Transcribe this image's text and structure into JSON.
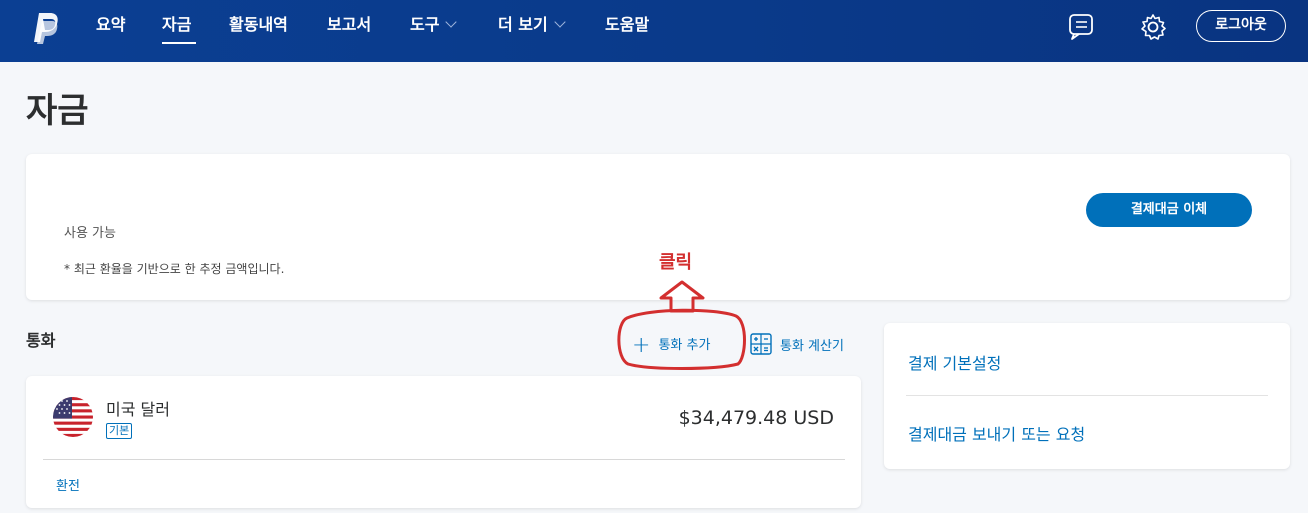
{
  "nav": {
    "items": [
      {
        "label": "요약"
      },
      {
        "label": "자금"
      },
      {
        "label": "활동내역"
      },
      {
        "label": "보고서"
      },
      {
        "label": "도구"
      },
      {
        "label": "더 보기"
      },
      {
        "label": "도움말"
      }
    ],
    "active_index": 1,
    "logout_label": "로그아웃",
    "icons": [
      "paypal-logo",
      "messages-icon",
      "gear-icon"
    ]
  },
  "page": {
    "title": "자금"
  },
  "balance": {
    "available_label": "사용 가능",
    "note": "* 최근 환율을 기반으로 한 추정 금액입니다.",
    "transfer_button": "결제대금 이체"
  },
  "annotation": {
    "label": "클릭",
    "color": "#d32f2f"
  },
  "currencies": {
    "title": "통화",
    "add_label": "통화 추가",
    "calculator_label": "통화 계산기",
    "items": [
      {
        "name": "미국 달러",
        "badge": "기본",
        "amount": "$34,479.48 USD",
        "convert_label": "환전",
        "flag_icon": "us-flag-icon"
      }
    ]
  },
  "side_links": {
    "items": [
      {
        "label": "결제 기본설정"
      },
      {
        "label": "결제대금 보내기 또는 요청"
      }
    ]
  },
  "colors": {
    "nav_bg": "#0b3f93",
    "accent": "#0070ba",
    "annotation": "#d32f2f",
    "page_bg": "#f5f7fa"
  }
}
